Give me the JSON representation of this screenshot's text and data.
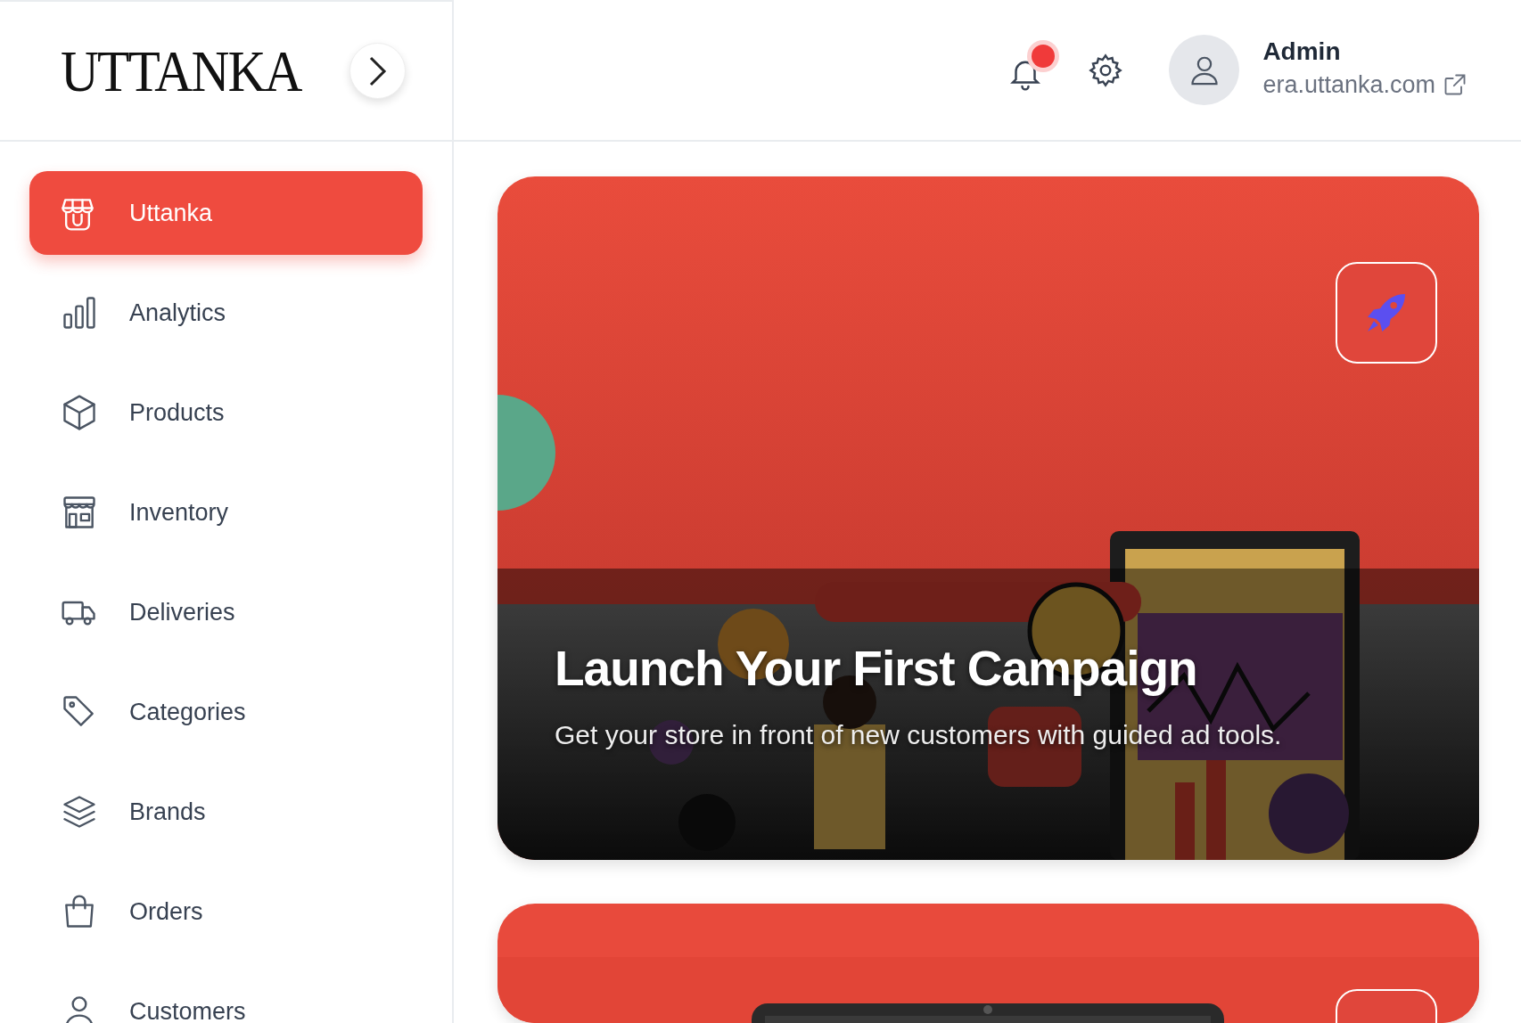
{
  "logo": {
    "text": "UTTANKA"
  },
  "header": {
    "notifications": {
      "unread": true
    },
    "user": {
      "name": "Admin",
      "site": "era.uttanka.com"
    }
  },
  "sidebar": {
    "items": [
      {
        "label": "Uttanka",
        "selected": true
      },
      {
        "label": "Analytics",
        "selected": false
      },
      {
        "label": "Products",
        "selected": false
      },
      {
        "label": "Inventory",
        "selected": false
      },
      {
        "label": "Deliveries",
        "selected": false
      },
      {
        "label": "Categories",
        "selected": false
      },
      {
        "label": "Brands",
        "selected": false
      },
      {
        "label": "Orders",
        "selected": false
      },
      {
        "label": "Customers",
        "selected": false
      }
    ]
  },
  "banners": [
    {
      "kind": "campaign",
      "title": "Launch Your First Campaign",
      "subtitle": "Get your store in front of new customers with guided ad tools."
    },
    {
      "kind": "storefront"
    }
  ]
}
